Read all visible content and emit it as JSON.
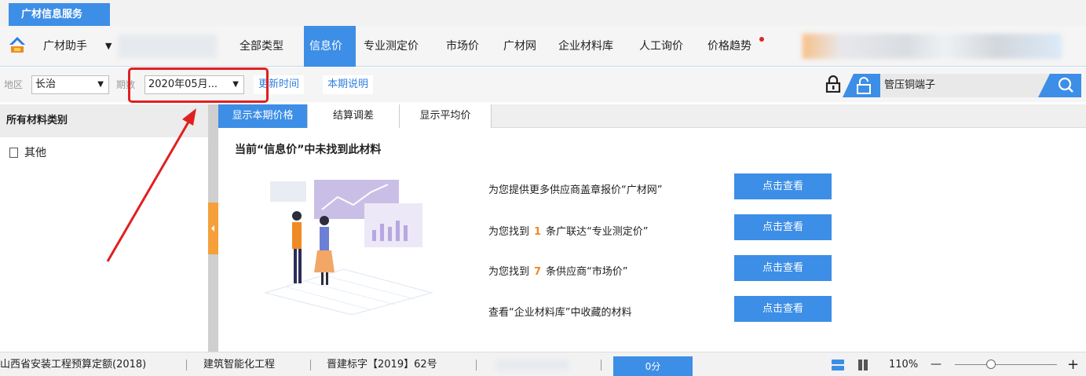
{
  "app_tab": {
    "label": "广材信息服务"
  },
  "toolbar": {
    "assistant_label": "广材助手",
    "nav": [
      {
        "label": "全部类型"
      },
      {
        "label": "信息价"
      },
      {
        "label": "专业测定价"
      },
      {
        "label": "市场价"
      },
      {
        "label": "广材网"
      },
      {
        "label": "企业材料库"
      },
      {
        "label": "人工询价"
      },
      {
        "label": "价格趋势"
      }
    ],
    "active_nav": "信息价"
  },
  "filters": {
    "region_label": "地区",
    "region_value": "长治",
    "period_label": "期数",
    "period_value": "2020年05月...",
    "update_time_label": "更新时间",
    "period_note_label": "本期说明",
    "search_value": "管压铜端子"
  },
  "left_panel": {
    "header": "所有材料类别",
    "items": [
      {
        "label": "其他"
      }
    ]
  },
  "subtabs": [
    {
      "label": "显示本期价格"
    },
    {
      "label": "结算调差"
    },
    {
      "label": "显示平均价"
    }
  ],
  "content": {
    "notice": "当前“信息价”中未找到此材料",
    "rows": [
      {
        "pre": "为您提供更多供应商盖章报价“广材网”",
        "num": "",
        "post": "",
        "button": "点击查看"
      },
      {
        "pre": "为您找到",
        "num": "1",
        "post": "条广联达“专业测定价”",
        "button": "点击查看"
      },
      {
        "pre": "为您找到",
        "num": "7",
        "post": "条供应商“市场价”",
        "button": "点击查看"
      },
      {
        "pre": "查看“企业材料库”中收藏的材料",
        "num": "",
        "post": "",
        "button": "点击查看"
      }
    ]
  },
  "statusbar": {
    "quota": "山西省安装工程预算定额(2018)",
    "specialty": "建筑智能化工程",
    "doc": "晋建标字【2019】62号",
    "score": "0分",
    "zoom": "110%",
    "zoom_level": 0.35,
    "zoom_minus": "—",
    "zoom_plus": "+"
  },
  "colors": {
    "accent": "#3d8ee6",
    "highlight": "#e02020",
    "orange": "#f08a24"
  },
  "icons": [
    "logo-icon",
    "chevron-down-icon",
    "lock-icon",
    "unlock-icon",
    "search-icon",
    "file-icon",
    "collapse-arrow-icon",
    "list-view-icon",
    "grid-view-icon"
  ]
}
